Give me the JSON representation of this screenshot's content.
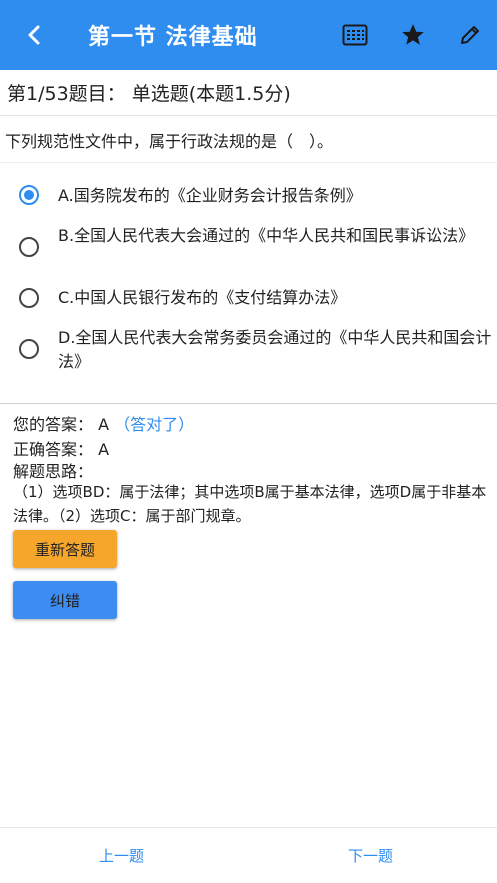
{
  "header": {
    "title": "第一节 法律基础",
    "icons": [
      "back-icon",
      "answer-sheet-icon",
      "star-icon",
      "pencil-icon"
    ],
    "color": "#2f8df0"
  },
  "question": {
    "heading": "第1/53题目： 单选题(本题1.5分)",
    "stem": "下列规范性文件中，属于行政法规的是（　）。",
    "options": [
      {
        "text": "A.国务院发布的《企业财务会计报告条例》",
        "selected": true
      },
      {
        "text": "B.全国人民代表大会通过的《中华人民共和国民事诉讼法》",
        "selected": false
      },
      {
        "text": "C.中国人民银行发布的《支付结算办法》",
        "selected": false
      },
      {
        "text": "D.全国人民代表大会常务委员会通过的《中华人民共和国会计法》",
        "selected": false
      }
    ]
  },
  "answer": {
    "your_label": "您的答案：",
    "your_value": "A",
    "result": "（答对了）",
    "correct_label": "正确答案：",
    "correct_value": "A",
    "explain_label": "解题思路：",
    "explain_text": "（1）选项BD：属于法律；其中选项B属于基本法律，选项D属于非基本法律。（2）选项C：属于部门规章。"
  },
  "buttons": {
    "retry": "重新答题",
    "report": "纠错"
  },
  "nav": {
    "prev": "上一题",
    "next": "下一题"
  }
}
